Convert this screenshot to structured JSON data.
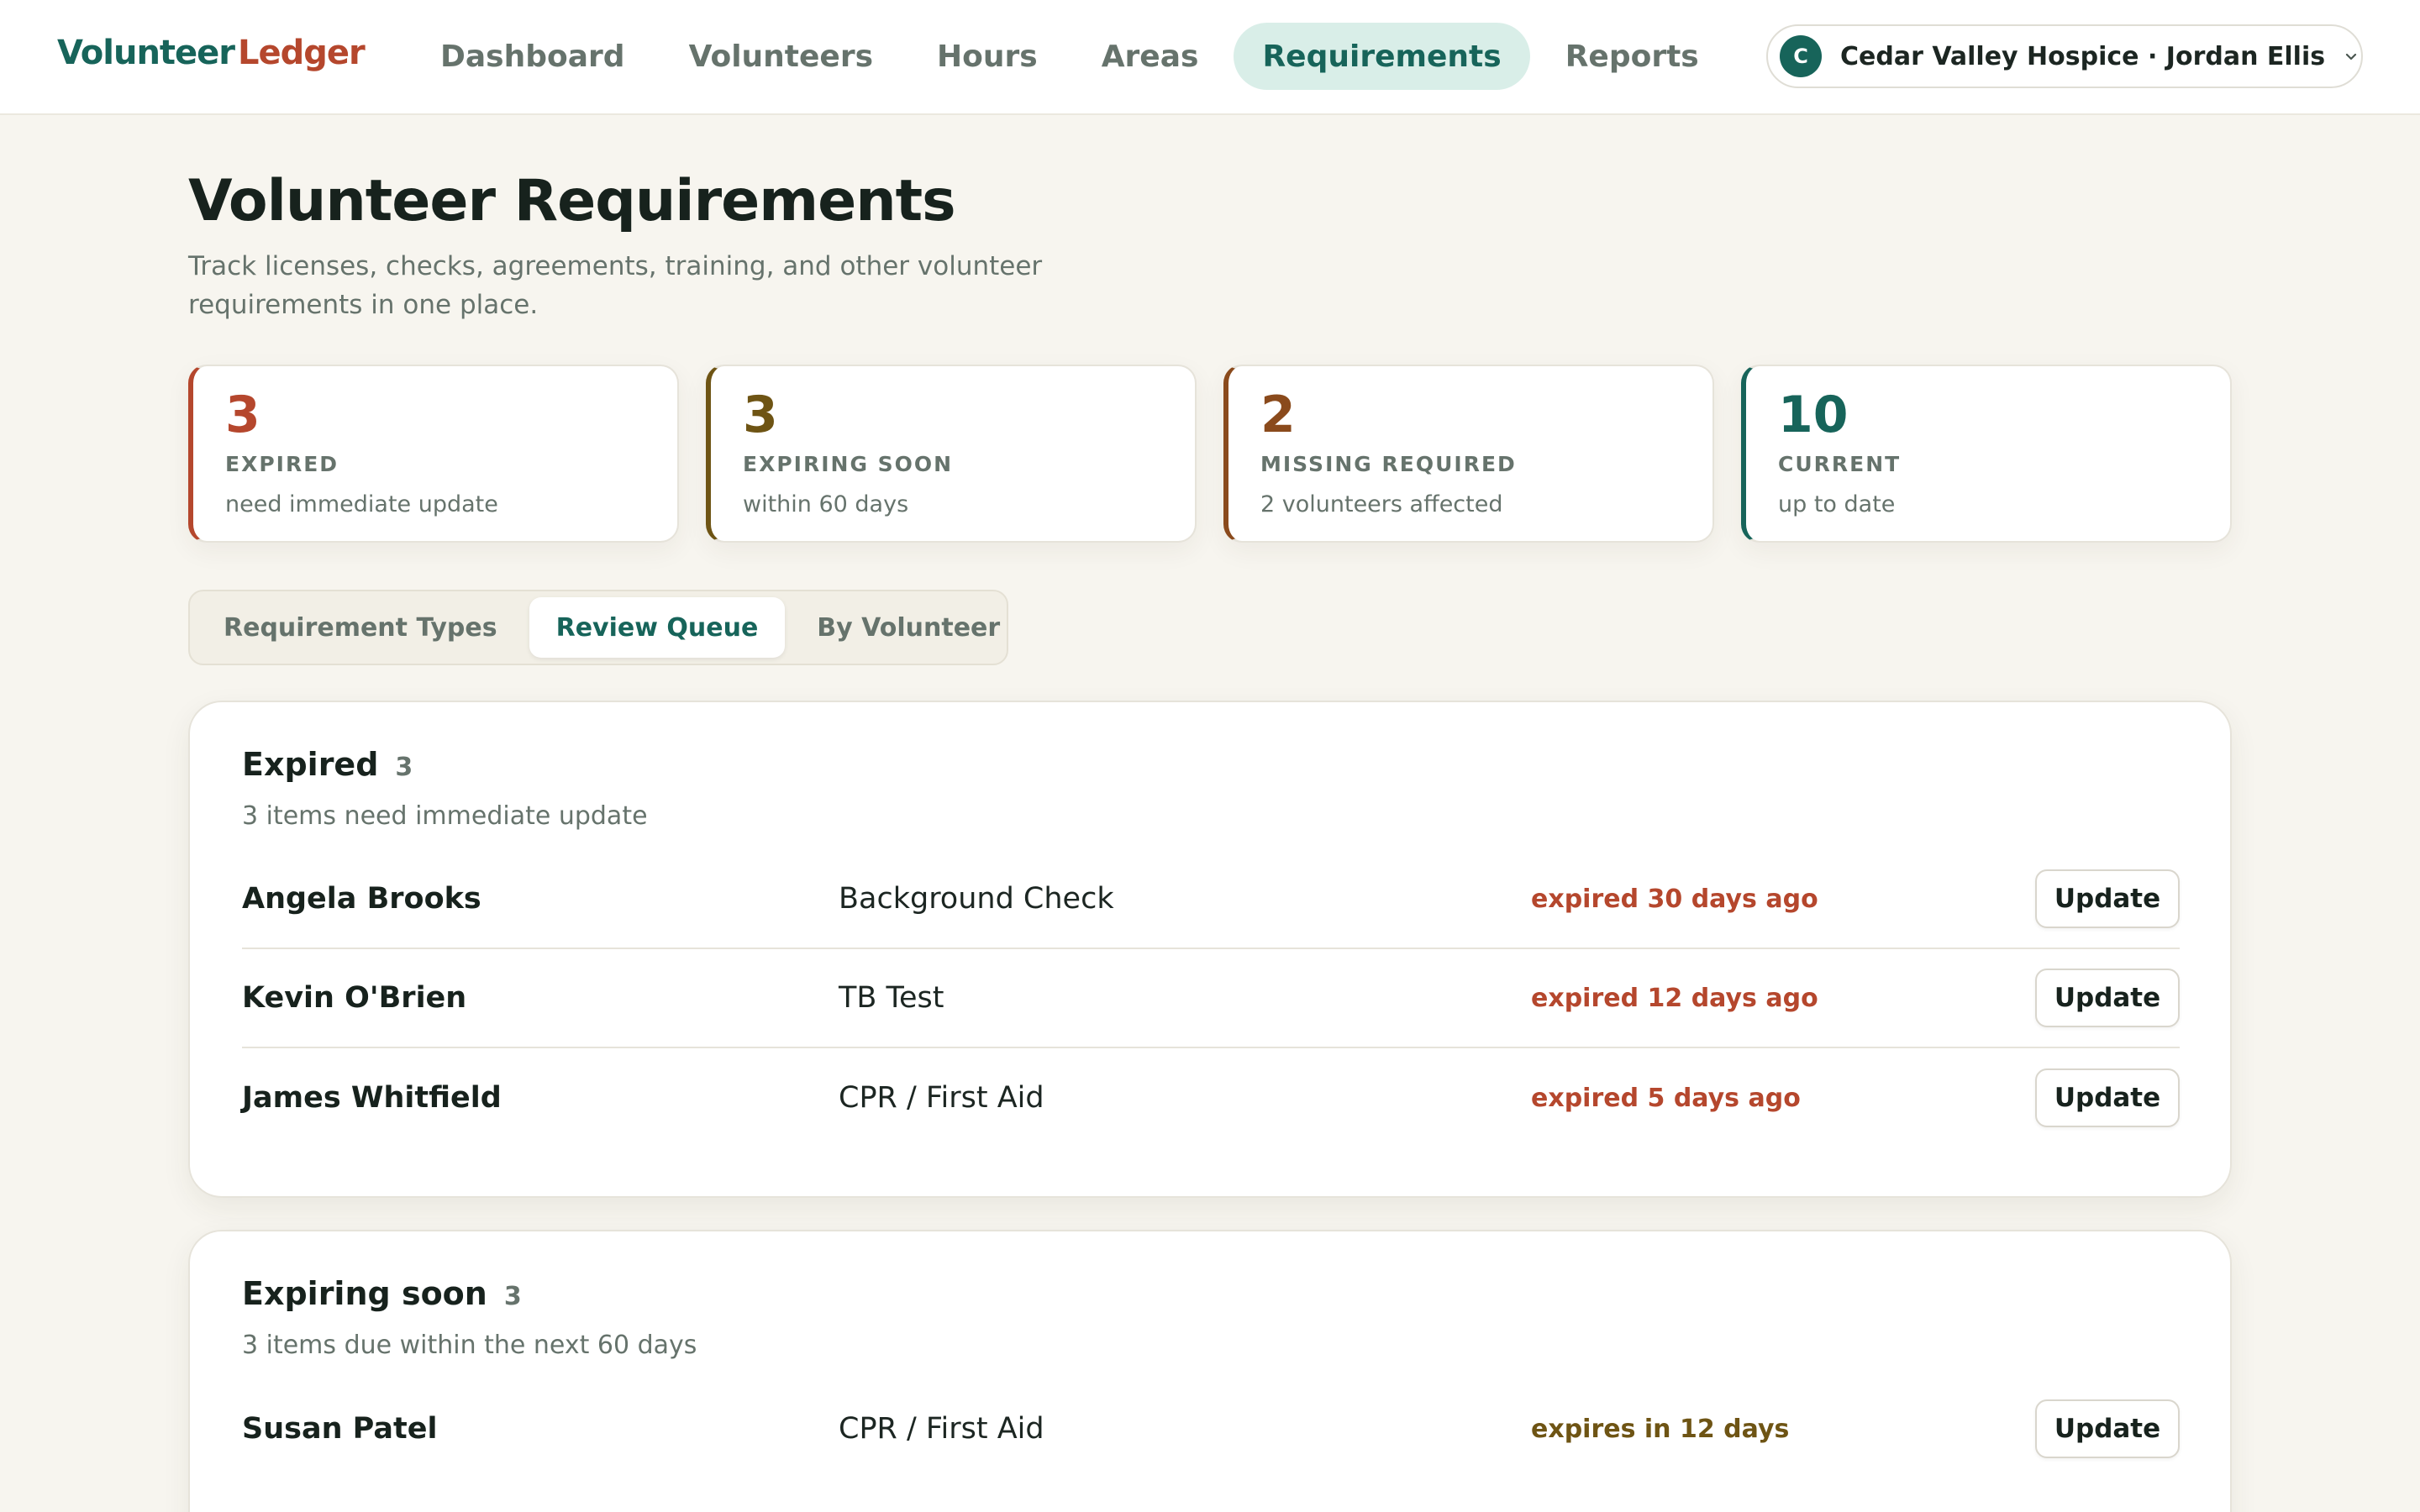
{
  "brand": {
    "part1": "Volunteer",
    "part2": "Ledger"
  },
  "nav": {
    "items": [
      {
        "label": "Dashboard",
        "active": false
      },
      {
        "label": "Volunteers",
        "active": false
      },
      {
        "label": "Hours",
        "active": false
      },
      {
        "label": "Areas",
        "active": false
      },
      {
        "label": "Requirements",
        "active": true
      },
      {
        "label": "Reports",
        "active": false
      }
    ]
  },
  "org": {
    "initial": "C",
    "name": "Cedar Valley Hospice · Jordan Ellis",
    "icon": "chevron-down-icon"
  },
  "header": {
    "title": "Volunteer Requirements",
    "subtitle": "Track licenses, checks, agreements, training, and other volunteer requirements in one place."
  },
  "stats": {
    "expired": {
      "value": "3",
      "label": "EXPIRED",
      "note": "need immediate update",
      "color": "#b5472d"
    },
    "soon": {
      "value": "3",
      "label": "EXPIRING SOON",
      "note": "within 60 days",
      "color": "#6e5414"
    },
    "missing": {
      "value": "2",
      "label": "MISSING REQUIRED",
      "note": "2 volunteers affected",
      "color": "#8a4a1c"
    },
    "current": {
      "value": "10",
      "label": "CURRENT",
      "note": "up to date",
      "color": "#17645a"
    }
  },
  "tabs": [
    {
      "label": "Requirement Types",
      "active": false
    },
    {
      "label": "Review Queue",
      "active": true
    },
    {
      "label": "By Volunteer",
      "active": false
    }
  ],
  "sections": {
    "expired": {
      "title": "Expired",
      "count": "3",
      "subtitle": "3 items need immediate update",
      "rows": [
        {
          "name": "Angela Brooks",
          "requirement": "Background Check",
          "status": "expired 30 days ago",
          "action": "Update"
        },
        {
          "name": "Kevin O'Brien",
          "requirement": "TB Test",
          "status": "expired 12 days ago",
          "action": "Update"
        },
        {
          "name": "James Whitfield",
          "requirement": "CPR / First Aid",
          "status": "expired 5 days ago",
          "action": "Update"
        }
      ]
    },
    "soon": {
      "title": "Expiring soon",
      "count": "3",
      "subtitle": "3 items due within the next 60 days",
      "rows": [
        {
          "name": "Susan Patel",
          "requirement": "CPR / First Aid",
          "status": "expires in 12 days",
          "action": "Update"
        }
      ]
    }
  }
}
